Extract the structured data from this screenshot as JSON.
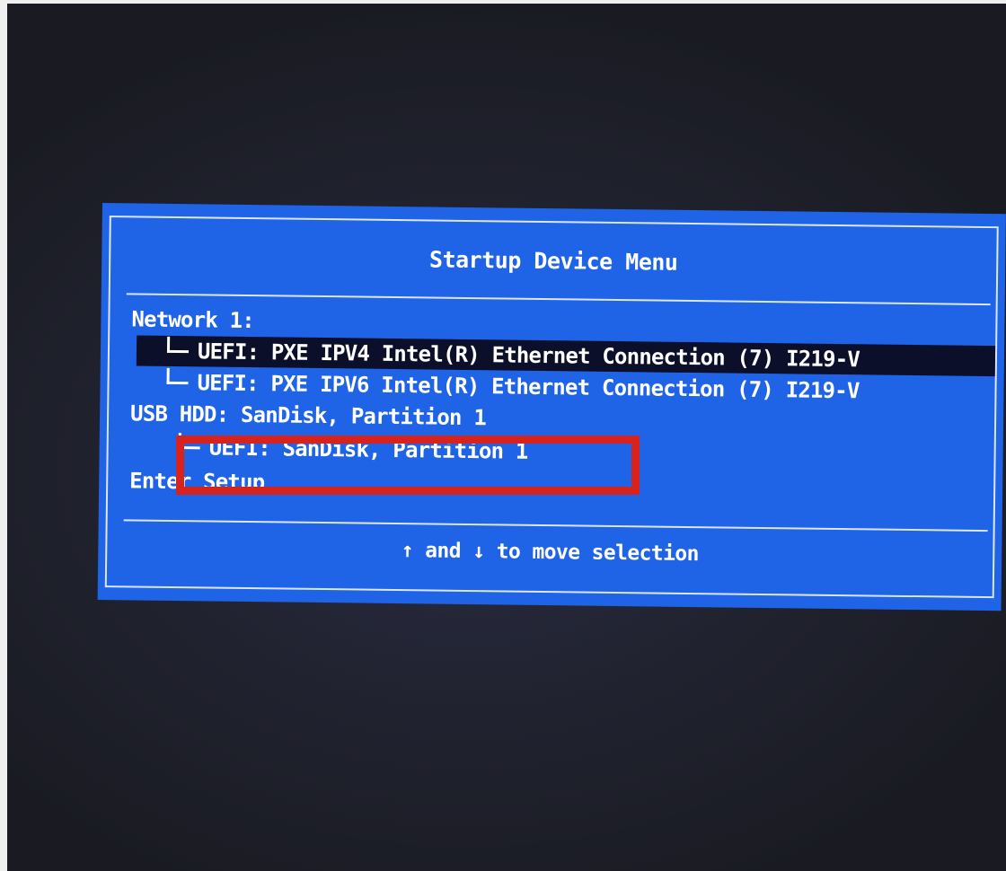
{
  "startup_menu": {
    "title": "Startup Device Menu",
    "items": [
      {
        "label": "Network 1:"
      },
      {
        "label": "UEFI: PXE IPV4 Intel(R) Ethernet Connection (7) I219-V",
        "selected": true
      },
      {
        "label": "UEFI: PXE IPV6 Intel(R) Ethernet Connection (7) I219-V"
      },
      {
        "label": "USB HDD:  SanDisk, Partition 1"
      },
      {
        "label": "UEFI: SanDisk, Partition 1"
      },
      {
        "label": "Enter Setup"
      }
    ],
    "hint": "↑ and ↓ to move selection"
  },
  "colors": {
    "menu_background": "#1f63e6",
    "selection_background": "#0b0f2a",
    "annotation_box": "#d8231d"
  }
}
